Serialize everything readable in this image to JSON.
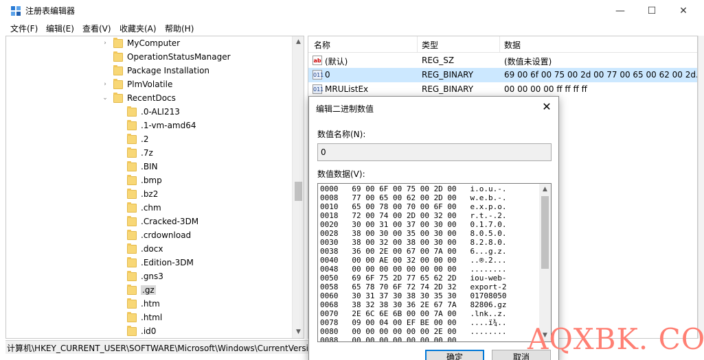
{
  "window": {
    "title": "注册表编辑器",
    "minimize_glyph": "—",
    "maximize_glyph": "☐",
    "close_glyph": "✕"
  },
  "menu": [
    "文件(F)",
    "编辑(E)",
    "查看(V)",
    "收藏夹(A)",
    "帮助(H)"
  ],
  "tree": {
    "items": [
      {
        "label": "MyComputer",
        "level": 0,
        "expander": "›"
      },
      {
        "label": "OperationStatusManager",
        "level": 0,
        "expander": ""
      },
      {
        "label": "Package Installation",
        "level": 0,
        "expander": ""
      },
      {
        "label": "PlmVolatile",
        "level": 0,
        "expander": "›"
      },
      {
        "label": "RecentDocs",
        "level": 0,
        "expander": "⌄"
      },
      {
        "label": ".0-ALI213",
        "level": 1,
        "expander": ""
      },
      {
        "label": ".1-vm-amd64",
        "level": 1,
        "expander": ""
      },
      {
        "label": ".2",
        "level": 1,
        "expander": ""
      },
      {
        "label": ".7z",
        "level": 1,
        "expander": ""
      },
      {
        "label": ".BIN",
        "level": 1,
        "expander": ""
      },
      {
        "label": ".bmp",
        "level": 1,
        "expander": ""
      },
      {
        "label": ".bz2",
        "level": 1,
        "expander": ""
      },
      {
        "label": ".chm",
        "level": 1,
        "expander": ""
      },
      {
        "label": ".Cracked-3DM",
        "level": 1,
        "expander": ""
      },
      {
        "label": ".crdownload",
        "level": 1,
        "expander": ""
      },
      {
        "label": ".docx",
        "level": 1,
        "expander": ""
      },
      {
        "label": ".Edition-3DM",
        "level": 1,
        "expander": ""
      },
      {
        "label": ".gns3",
        "level": 1,
        "expander": ""
      },
      {
        "label": ".gz",
        "level": 1,
        "expander": "",
        "selected": true
      },
      {
        "label": ".htm",
        "level": 1,
        "expander": ""
      },
      {
        "label": ".html",
        "level": 1,
        "expander": ""
      },
      {
        "label": ".id0",
        "level": 1,
        "expander": ""
      }
    ],
    "scroll_up": "▲",
    "scroll_down": "▼"
  },
  "status": {
    "path": "计算机\\HKEY_CURRENT_USER\\SOFTWARE\\Microsoft\\Windows\\CurrentVersio"
  },
  "list": {
    "headers": {
      "name": "名称",
      "type": "类型",
      "data": "数据"
    },
    "rows": [
      {
        "icon": "ab",
        "icon_text": "ab",
        "name": "(默认)",
        "type": "REG_SZ",
        "data": "(数值未设置)",
        "selected": false
      },
      {
        "icon": "bin",
        "icon_text": "011",
        "name": "0",
        "type": "REG_BINARY",
        "data": "69 00 6f 00 75 00 2d 00 77 00 65 00 62 00 2d...",
        "selected": true
      },
      {
        "icon": "bin",
        "icon_text": "011",
        "name": "MRUListEx",
        "type": "REG_BINARY",
        "data": "00 00 00 00 ff ff ff ff",
        "selected": false
      }
    ]
  },
  "dialog": {
    "title": "编辑二进制数值",
    "close_glyph": "✕",
    "name_label": "数值名称(N):",
    "name_value": "0",
    "data_label": "数值数据(V):",
    "hex_lines": [
      "0000   69 00 6F 00 75 00 2D 00   i.o.u.-.",
      "0008   77 00 65 00 62 00 2D 00   w.e.b.-.",
      "0010   65 00 78 00 70 00 6F 00   e.x.p.o.",
      "0018   72 00 74 00 2D 00 32 00   r.t.-.2.",
      "0020   30 00 31 00 37 00 30 00   0.1.7.0.",
      "0028   38 00 30 00 35 00 30 00   8.0.5.0.",
      "0030   38 00 32 00 38 00 30 00   8.2.8.0.",
      "0038   36 00 2E 00 67 00 7A 00   6...g.z.",
      "0040   00 00 AE 00 32 00 00 00   ..®.2...",
      "0048   00 00 00 00 00 00 00 00   ........",
      "0050   69 6F 75 2D 77 65 62 2D   iou-web-",
      "0058   65 78 70 6F 72 74 2D 32   export-2",
      "0060   30 31 37 30 38 30 35 30   01708050",
      "0068   38 32 38 30 36 2E 67 7A   82806.gz",
      "0070   2E 6C 6E 6B 00 00 7A 00   .lnk..z.",
      "0078   09 00 04 00 EF BE 00 00   ....ï¾..",
      "0080   00 00 00 00 00 00 2E 00   ........",
      "0088   00 00 00 00 00 00 00 00   ........"
    ],
    "scroll_up": "▲",
    "scroll_down": "▼",
    "ok_label": "确定",
    "cancel_label": "取消"
  },
  "watermark": "AQXBK. COM",
  "colors": {
    "selection": "#cce8ff",
    "tree_selection": "#d9d9d9",
    "folder": "#f8d776",
    "ok_border": "#0078d7",
    "watermark": "#ff7f73"
  }
}
